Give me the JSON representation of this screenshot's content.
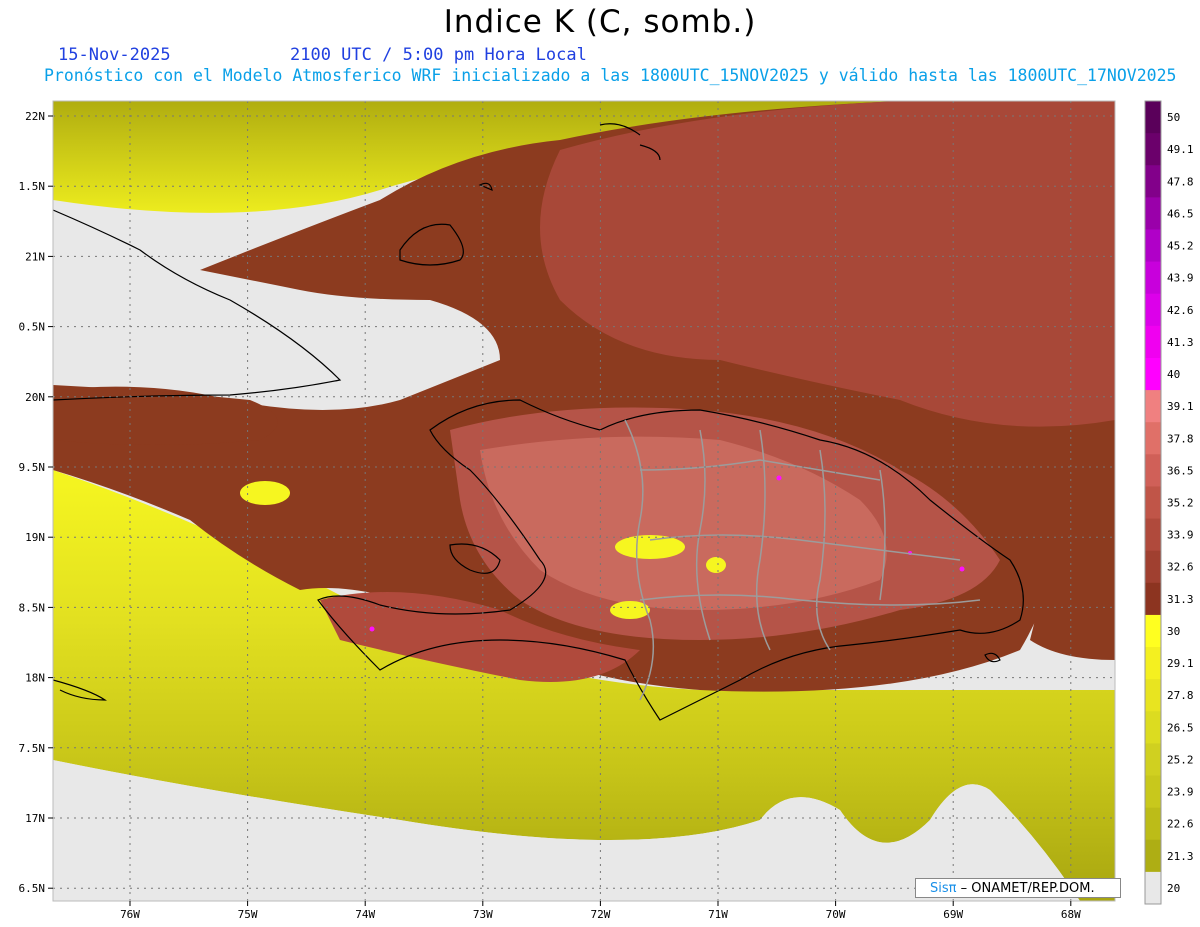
{
  "title": "Indice K (C, somb.)",
  "date": "15-Nov-2025",
  "time": "2100 UTC / 5:00 pm Hora Local",
  "subtitle": "Pronóstico con el Modelo Atmosferico WRF inicializado a las 1800UTC_15NOV2025 y válido hasta las  1800UTC_17NOV2025",
  "lat_labels": [
    "22N",
    "1.5N",
    "21N",
    "0.5N",
    "20N",
    "9.5N",
    "19N",
    "8.5N",
    "18N",
    "7.5N",
    "17N",
    "6.5N"
  ],
  "lon_labels": [
    "76W",
    "75W",
    "74W",
    "73W",
    "72W",
    "71W",
    "70W",
    "69W",
    "68W"
  ],
  "colorbar": {
    "labels": [
      "50",
      "49.1",
      "47.8",
      "46.5",
      "45.2",
      "43.9",
      "42.6",
      "41.3",
      "40",
      "39.1",
      "37.8",
      "36.5",
      "35.2",
      "33.9",
      "32.6",
      "31.3",
      "30",
      "29.1",
      "27.8",
      "26.5",
      "25.2",
      "23.9",
      "22.6",
      "21.3",
      "20"
    ],
    "colors": [
      "#5a005a",
      "#6b006b",
      "#82008a",
      "#9a00aa",
      "#b000c8",
      "#c800dc",
      "#dc00ea",
      "#f000f0",
      "#ff00ff",
      "#f08080",
      "#e07068",
      "#d06058",
      "#c05548",
      "#b04a3c",
      "#a04030",
      "#8c3420",
      "#ffff20",
      "#f4f020",
      "#e8e420",
      "#dcdc20",
      "#d0d020",
      "#c8c81c",
      "#bcbc18",
      "#aeae14",
      "#e8e8e8"
    ]
  },
  "credit": {
    "brand": "Sisπ",
    "org": "– ONAMET/REP.DOM."
  },
  "colors": {
    "ocean_low": "#e6e6e6",
    "yellow": "#f5f520",
    "brown_dark": "#8a3a1e",
    "brown_mid": "#a9483a",
    "brown_light": "#c8685c",
    "magenta": "#ff10ff"
  }
}
